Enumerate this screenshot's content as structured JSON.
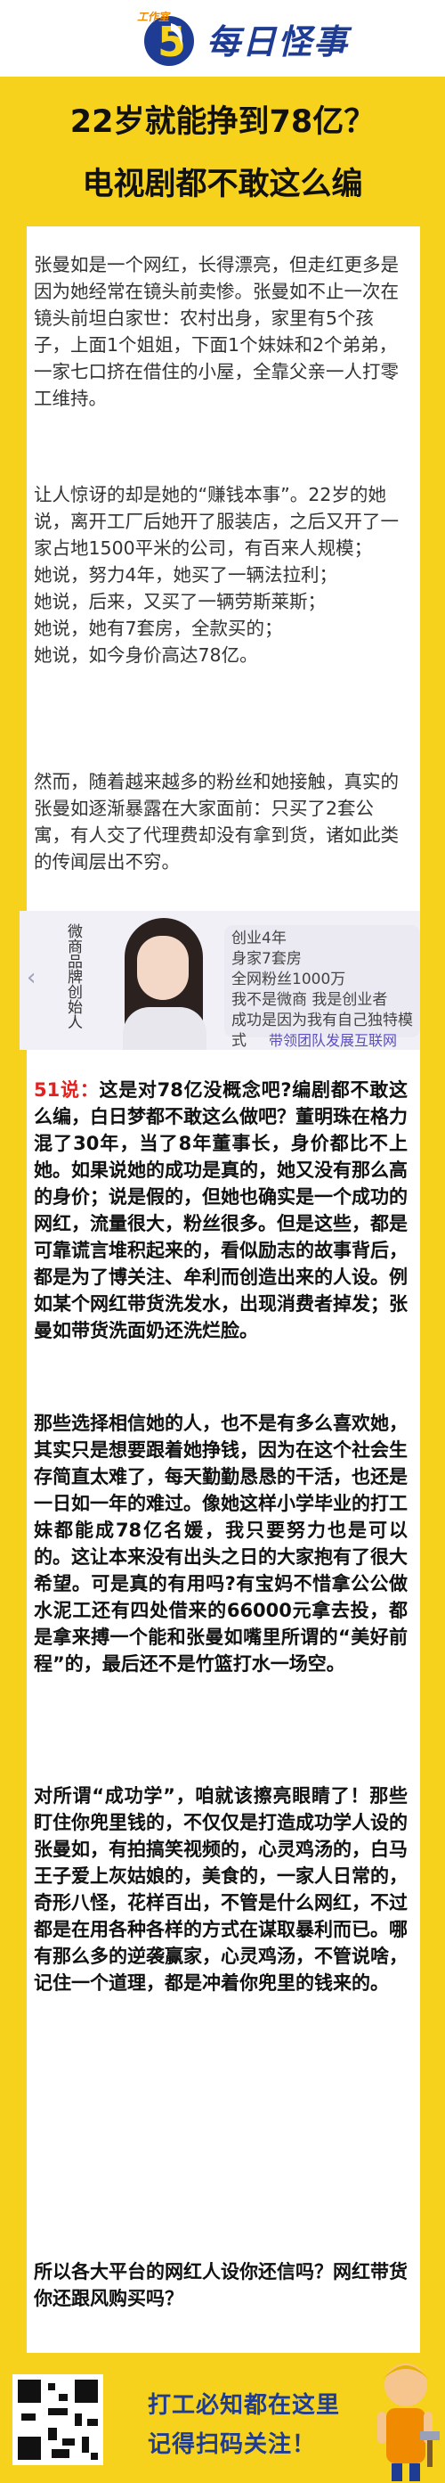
{
  "header": {
    "logo_tag": "工作室",
    "logo_text": "每日怪事"
  },
  "title": {
    "line1": "22岁就能挣到78亿？",
    "line2": "电视剧都不敢这么编"
  },
  "paragraphs": [
    "张曼如是一个网红，长得漂亮，但走红更多是因为她经常在镜头前卖惨。张曼如不止一次在镜头前坦白家世：农村出身，家里有5个孩子，上面1个姐姐，下面1个妹妹和2个弟弟，一家七口挤在借住的小屋，全靠父亲一人打零工维持。",
    "让人惊讶的却是她的“赚钱本事”。22岁的她说，离开工厂后她开了服装店，之后又开了一家占地1500平米的公司，有百来人规模；\n她说，努力4年，她买了一辆法拉利；\n她说，后来，又买了一辆劳斯莱斯；\n她说，她有7套房，全款买的；\n她说，如今身价高达78亿。",
    "然而，随着越来越多的粉丝和她接触，真实的张曼如逐渐暴露在大家面前：只买了2套公寓，有人交了代理费却没有拿到货，诸如此类的传闻层出不穷。"
  ],
  "banner": {
    "vertical_text": "微商品牌创始人",
    "lines": [
      "创业4年",
      "身家7套房",
      "全网粉丝1000万",
      "我不是微商 我是创业者",
      "成功是因为我有自己独特模式"
    ],
    "footer": "带领团队发展互联网"
  },
  "comments": {
    "prefix": "51说：",
    "p1": "这是对78亿没概念吧?编剧都不敢这么编，白日梦都不敢这么做吧？董明珠在格力混了30年，当了8年董事长，身价都比不上她。如果说她的成功是真的，她又没有那么高的身价；说是假的，但她也确实是一个成功的网红，流量很大，粉丝很多。但是这些，都是可靠谎言堆积起来的，看似励志的故事背后，都是为了博关注、牟利而创造出来的人设。例如某个网红带货洗发水，出现消费者掉发；张曼如带货洗面奶还洗烂脸。",
    "p2": "那些选择相信她的人，也不是有多么喜欢她，其实只是想要跟着她挣钱，因为在这个社会生存简直太难了，每天勤勤恳恳的干活，也还是一日如一年的难过。像她这样小学毕业的打工妹都能成78亿名媛，我只要努力也是可以的。这让本来没有出头之日的大家抱有了很大希望。可是真的有用吗?有宝妈不惜拿公公做水泥工还有四处借来的66000元拿去投，都是拿来搏一个能和张曼如嘴里所谓的“美好前程”的，最后还不是竹篮打水一场空。",
    "p3": "对所谓“成功学”，咱就该擦亮眼睛了！那些盯住你兜里钱的，不仅仅是打造成功学人设的张曼如，有拍搞笑视频的，心灵鸡汤的，白马王子爱上灰姑娘的，美食的，一家人日常的，奇形八怪，花样百出，不管是什么网红，不过都是在用各种各样的方式在谋取暴利而已。哪有那么多的逆袭赢家，心灵鸡汤，不管说啥，记住一个道理，都是冲着你兜里的钱来的。",
    "p4": "所以各大平台的网红人设你还信吗？网红带货你还跟风购买吗？"
  },
  "footer": {
    "line1": "打工必知都在这里",
    "line2": "记得扫码关注！"
  },
  "colors": {
    "background": "#f7d21c",
    "accent_blue": "#1e3c93",
    "accent_red": "#e3211f"
  }
}
